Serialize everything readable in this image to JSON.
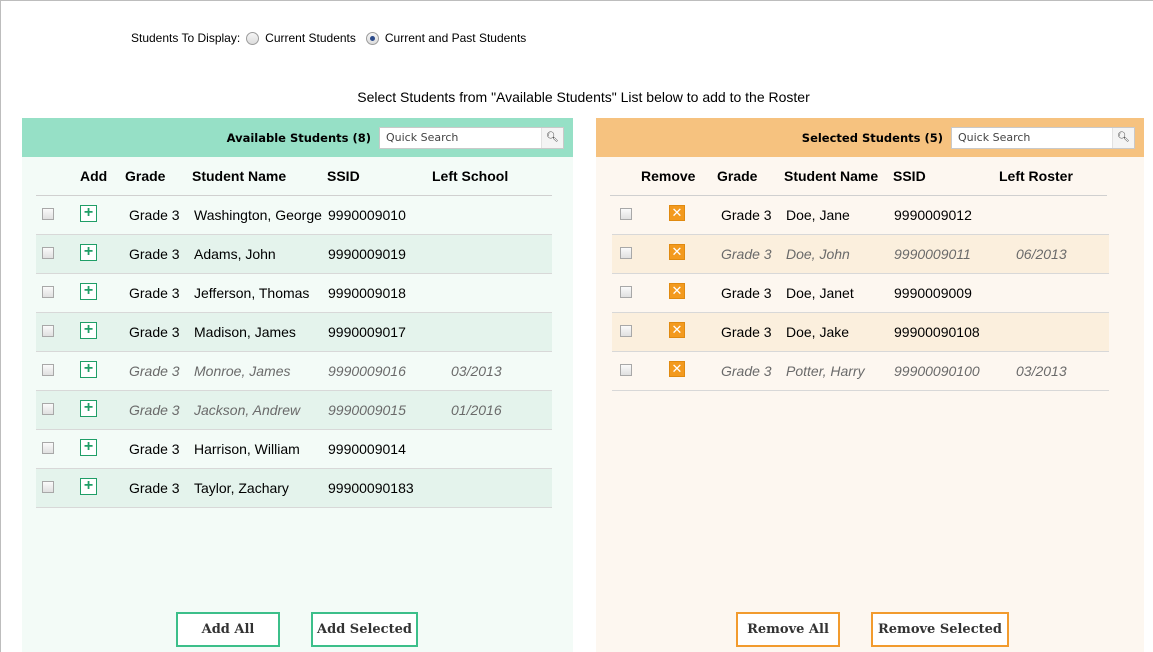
{
  "display_filter": {
    "label": "Students To Display:",
    "options": [
      {
        "label": "Current Students",
        "checked": false
      },
      {
        "label": "Current and Past Students",
        "checked": true
      }
    ]
  },
  "instruction": "Select Students from \"Available Students\" List below to add to the Roster",
  "available": {
    "title": "Available Students (8)",
    "search_placeholder": "Quick Search",
    "columns": {
      "add": "Add",
      "grade": "Grade",
      "name": "Student Name",
      "ssid": "SSID",
      "left": "Left School"
    },
    "rows": [
      {
        "grade": "Grade 3",
        "name": "Washington, George",
        "ssid": "9990009010",
        "left": ""
      },
      {
        "grade": "Grade 3",
        "name": "Adams, John",
        "ssid": "9990009019",
        "left": ""
      },
      {
        "grade": "Grade 3",
        "name": "Jefferson, Thomas",
        "ssid": "9990009018",
        "left": ""
      },
      {
        "grade": "Grade 3",
        "name": "Madison, James",
        "ssid": "9990009017",
        "left": ""
      },
      {
        "grade": "Grade 3",
        "name": "Monroe, James",
        "ssid": "9990009016",
        "left": "03/2013"
      },
      {
        "grade": "Grade 3",
        "name": "Jackson, Andrew",
        "ssid": "9990009015",
        "left": "01/2016"
      },
      {
        "grade": "Grade 3",
        "name": "Harrison, William",
        "ssid": "9990009014",
        "left": ""
      },
      {
        "grade": "Grade 3",
        "name": "Taylor, Zachary",
        "ssid": "99900090183",
        "left": ""
      }
    ],
    "add_all_label": "Add All",
    "add_selected_label": "Add Selected"
  },
  "selected": {
    "title": "Selected Students (5)",
    "search_placeholder": "Quick Search",
    "columns": {
      "remove": "Remove",
      "grade": "Grade",
      "name": "Student Name",
      "ssid": "SSID",
      "left": "Left Roster"
    },
    "rows": [
      {
        "grade": "Grade 3",
        "name": "Doe, Jane",
        "ssid": "9990009012",
        "left": ""
      },
      {
        "grade": "Grade 3",
        "name": "Doe, John",
        "ssid": "9990009011",
        "left": "06/2013"
      },
      {
        "grade": "Grade 3",
        "name": "Doe, Janet",
        "ssid": "9990009009",
        "left": ""
      },
      {
        "grade": "Grade 3",
        "name": "Doe, Jake",
        "ssid": "99900090108",
        "left": ""
      },
      {
        "grade": "Grade 3",
        "name": "Potter, Harry",
        "ssid": "99900090100",
        "left": "03/2013"
      }
    ],
    "remove_all_label": "Remove All",
    "remove_selected_label": "Remove Selected"
  },
  "colors": {
    "available_header": "#96e0c6",
    "selected_header": "#f6c27f",
    "add_icon": "#1f9e67",
    "remove_icon": "#f39a1e"
  },
  "icons": {
    "add": "plus-icon",
    "remove": "close-icon",
    "search": "magnifier-icon"
  }
}
